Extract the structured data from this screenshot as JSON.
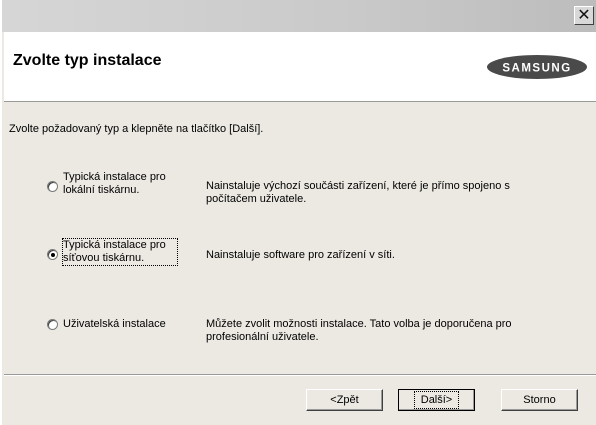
{
  "window": {
    "close_symbol": "✕"
  },
  "header": {
    "title": "Zvolte typ instalace",
    "logo_text": "SAMSUNG"
  },
  "instruction": "Zvolte požadovaný typ a klepněte na tlačítko [Další].",
  "options": [
    {
      "label_line1": "Typická instalace pro",
      "label_line2": "lokální tiskárnu.",
      "description_line1": "Nainstaluje výchozí součásti zařízení, které je přímo spojeno s",
      "description_line2": "počítačem uživatele.",
      "selected": false
    },
    {
      "label_line1": "Typická instalace pro",
      "label_line2": "síťovou tiskárnu.",
      "description_line1": "Nainstaluje software pro zařízení v síti.",
      "description_line2": "",
      "selected": true
    },
    {
      "label_line1": "Uživatelská instalace",
      "label_line2": "",
      "description_line1": "Můžete zvolit možnosti instalace. Tato volba je doporučena pro",
      "description_line2": "profesionální uživatele.",
      "selected": false
    }
  ],
  "buttons": {
    "back": "<Zpět",
    "next": "Další>",
    "cancel": "Storno"
  },
  "icons": {
    "close": "close-icon",
    "logo": "samsung-logo"
  },
  "colors": {
    "window_bg": "#ece9e3",
    "header_bg": "#ffffff",
    "logo_fill": "#4a4a4a"
  }
}
